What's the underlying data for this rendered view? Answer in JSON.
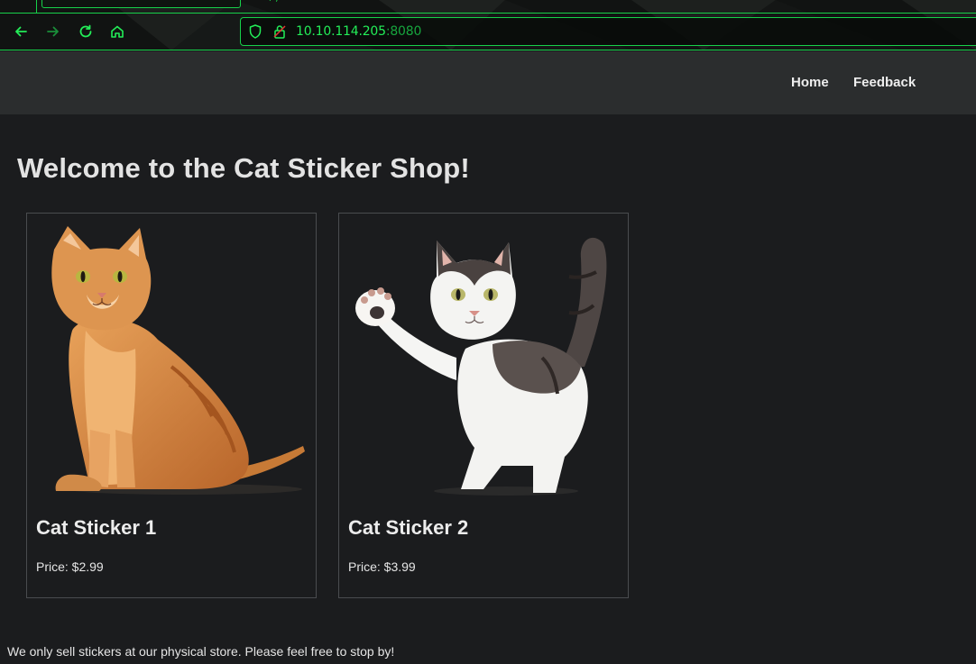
{
  "browser": {
    "tab_fragment": "r ,",
    "url_host": "10.10.114.205",
    "url_port": ":8080",
    "icons": {
      "back": "arrow-left-icon",
      "forward": "arrow-right-icon",
      "reload": "reload-icon",
      "home": "home-icon",
      "tracking": "shield-icon",
      "security": "lock-icon"
    },
    "accent_color": "#17d14a"
  },
  "nav": {
    "home": "Home",
    "feedback": "Feedback"
  },
  "page": {
    "title": "Welcome to the Cat Sticker Shop!",
    "footer": "We only sell stickers at our physical store. Please feel free to stop by!"
  },
  "products": [
    {
      "name": "Cat Sticker 1",
      "price": "Price: $2.99"
    },
    {
      "name": "Cat Sticker 2",
      "price": "Price: $3.99"
    }
  ]
}
